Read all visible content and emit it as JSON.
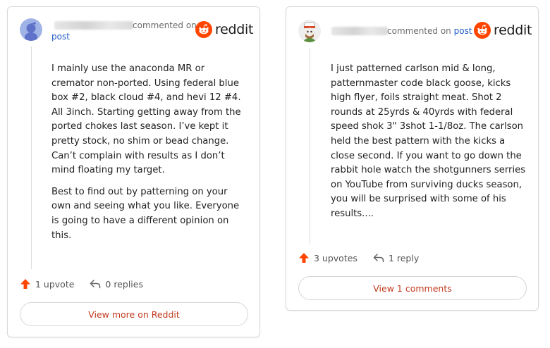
{
  "colors": {
    "reddit_orange": "#ff4500",
    "link_blue": "#1f5bc4",
    "button_text": "#c23a1e"
  },
  "comments": [
    {
      "avatar_icon": "snoo-avatar-blue-icon",
      "meta": "commented on",
      "post_link": "post",
      "brand": "reddit",
      "paragraphs": [
        "I mainly use the anaconda MR or cremator non-ported. Using federal blue box #2, black cloud #4, and hevi 12 #4. All 3inch. Starting getting away from the ported chokes last season. I’ve kept it pretty stock, no shim or bead change. Can’t complain with results as I don’t mind floating my target.",
        "Best to find out by patterning on your own and seeing what you like. Everyone is going to have a different opinion on this."
      ],
      "upvotes": "1 upvote",
      "replies": "0 replies",
      "footer_button": "View more on Reddit"
    },
    {
      "avatar_icon": "snoo-avatar-hat-icon",
      "meta": "commented on",
      "post_link": "post",
      "brand": "reddit",
      "paragraphs": [
        "I just patterned carlson mid & long, patternmaster code black goose, kicks high flyer, foils straight meat. Shot 2 rounds at 25yrds & 40yrds with federal speed shok 3\" 3shot 1-1/8oz. The carlson held the best pattern with the kicks a close second. If you want to go down the rabbit hole watch the shotgunners serries on YouTube from surviving ducks season, you will be surprised with some of his results...."
      ],
      "upvotes": "3 upvotes",
      "replies": "1 reply",
      "footer_button": "View 1 comments"
    }
  ]
}
